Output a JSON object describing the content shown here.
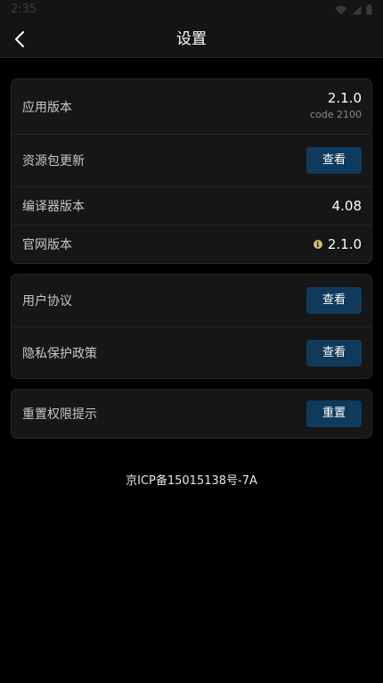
{
  "status_bar": {
    "time": "2:35"
  },
  "header": {
    "title": "设置",
    "back_icon": "chevron-left-icon"
  },
  "section_about": {
    "app_version_label": "应用版本",
    "app_version_value": "2.1.0",
    "app_version_code": "code 2100",
    "resource_update_label": "资源包更新",
    "resource_update_button": "查看",
    "compiler_version_label": "编译器版本",
    "compiler_version_value": "4.08",
    "official_version_label": "官网版本",
    "official_version_value": "2.1.0"
  },
  "section_legal": {
    "user_agreement_label": "用户协议",
    "user_agreement_button": "查看",
    "privacy_policy_label": "隐私保护政策",
    "privacy_policy_button": "查看"
  },
  "section_permission": {
    "reset_permission_label": "重置权限提示",
    "reset_permission_button": "重置"
  },
  "footer": {
    "icp": "京ICP备15015138号-7A"
  },
  "colors": {
    "background": "#000000",
    "card": "#161616",
    "button": "#0f3a5c",
    "info_icon": "#d8b978"
  }
}
